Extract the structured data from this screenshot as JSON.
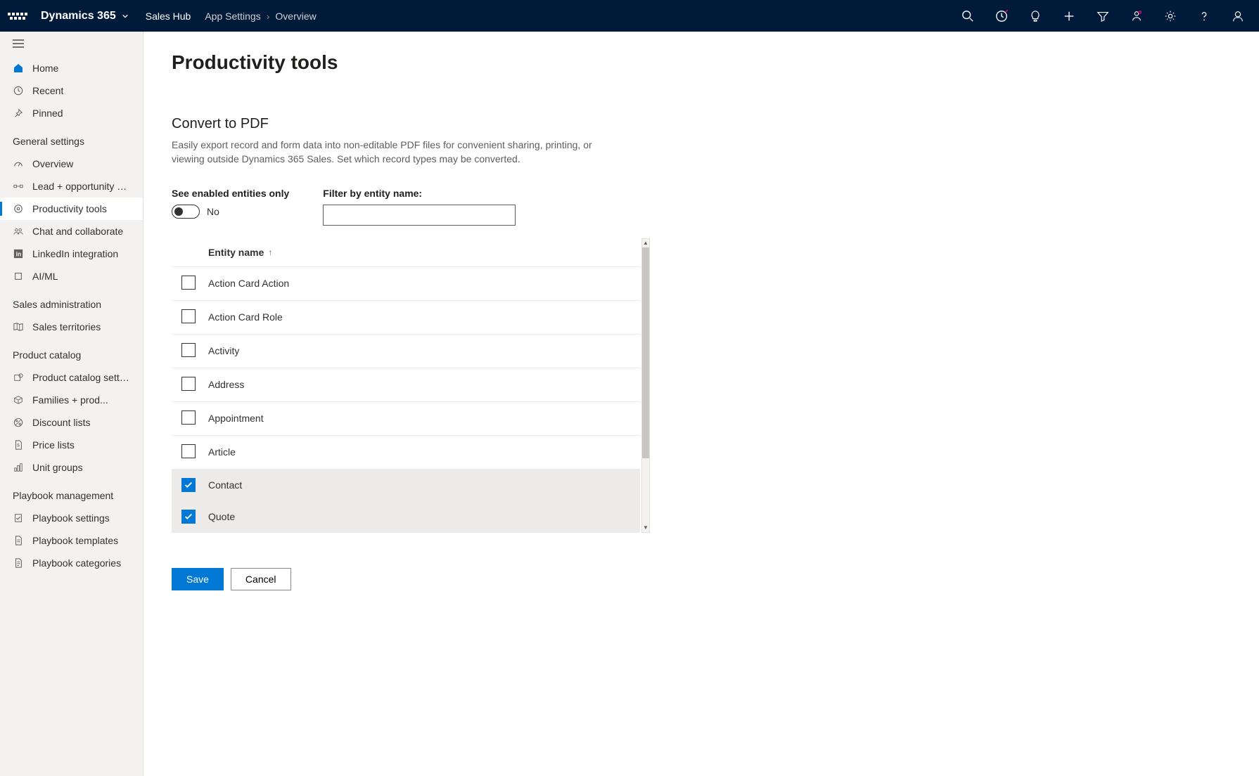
{
  "header": {
    "brand": "Dynamics 365",
    "app_name": "Sales Hub",
    "breadcrumb": [
      "App Settings",
      "Overview"
    ]
  },
  "sidebar": {
    "top": [
      {
        "label": "Home",
        "icon": "home"
      },
      {
        "label": "Recent",
        "icon": "clock"
      },
      {
        "label": "Pinned",
        "icon": "pin"
      }
    ],
    "sections": [
      {
        "title": "General settings",
        "items": [
          {
            "label": "Overview",
            "icon": "gauge"
          },
          {
            "label": "Lead + opportunity ma...",
            "icon": "flow"
          },
          {
            "label": "Productivity tools",
            "icon": "target",
            "active": true
          },
          {
            "label": "Chat and collaborate",
            "icon": "people"
          },
          {
            "label": "LinkedIn integration",
            "icon": "linkedin"
          },
          {
            "label": "AI/ML",
            "icon": "cube"
          }
        ]
      },
      {
        "title": "Sales administration",
        "items": [
          {
            "label": "Sales territories",
            "icon": "map"
          }
        ]
      },
      {
        "title": "Product catalog",
        "items": [
          {
            "label": "Product catalog settings",
            "icon": "box-gear"
          },
          {
            "label": "Families + prod...",
            "icon": "cube2"
          },
          {
            "label": "Discount lists",
            "icon": "percent"
          },
          {
            "label": "Price lists",
            "icon": "doc-money"
          },
          {
            "label": "Unit groups",
            "icon": "chart"
          }
        ]
      },
      {
        "title": "Playbook management",
        "items": [
          {
            "label": "Playbook settings",
            "icon": "check-doc"
          },
          {
            "label": "Playbook templates",
            "icon": "doc"
          },
          {
            "label": "Playbook categories",
            "icon": "doc2"
          }
        ]
      }
    ]
  },
  "main": {
    "page_title": "Productivity tools",
    "section_title": "Convert to PDF",
    "section_desc": "Easily export record and form data into non-editable PDF files for convenient sharing, printing, or viewing outside Dynamics 365 Sales. Set which record types may be converted.",
    "toggle_label": "See enabled entities only",
    "toggle_value": "No",
    "filter_label": "Filter by entity name:",
    "filter_value": "",
    "col_header": "Entity name",
    "entities": [
      {
        "name": "Action Card Action",
        "checked": false
      },
      {
        "name": "Action Card Role",
        "checked": false
      },
      {
        "name": "Activity",
        "checked": false
      },
      {
        "name": "Address",
        "checked": false
      },
      {
        "name": "Appointment",
        "checked": false
      },
      {
        "name": "Article",
        "checked": false
      },
      {
        "name": "Contact",
        "checked": true
      },
      {
        "name": "Quote",
        "checked": true
      }
    ],
    "save_label": "Save",
    "cancel_label": "Cancel"
  }
}
